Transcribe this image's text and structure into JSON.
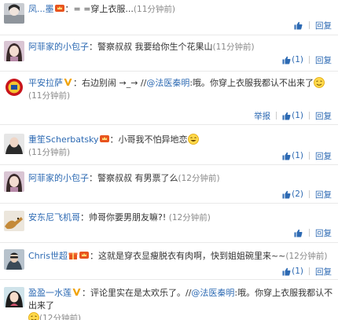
{
  "comments": [
    {
      "user": "凤...墨",
      "text": "= =穿上衣服...",
      "time": "(11分钟前)",
      "likes": "",
      "reply": "回复"
    },
    {
      "user": "阿菲家的小包子",
      "text": "警察叔叔 我要给你生个花果山",
      "time": "(11分钟前)",
      "likes": "(1)",
      "reply": "回复"
    },
    {
      "user": "平安拉萨",
      "text_before": "右边别闹 →_→ //",
      "mention": "@法医秦明",
      "text_after": ":哦。你穿上衣服我都认不出来了",
      "time": "(11分钟前)",
      "report": "举报",
      "likes": "(1)",
      "reply": "回复"
    },
    {
      "user": "重笙Scherbatsky",
      "text": "小哥我不怕异地恋",
      "time": "(11分钟前)",
      "likes": "(1)",
      "reply": "回复"
    },
    {
      "user": "阿菲家的小包子",
      "text": "警察叔叔 有男票了么",
      "time": "(12分钟前)",
      "likes": "(2)",
      "reply": "回复"
    },
    {
      "user": "安东尼飞机哥",
      "text": "帅哥你要男朋友嘛?!",
      "time": "(12分钟前)",
      "likes": "",
      "reply": "回复"
    },
    {
      "user": "Chris世超",
      "text": "这就是穿衣显瘦脱衣有肉啊，快到姐姐碗里来~~",
      "time": "(12分钟前)",
      "likes": "(1)",
      "reply": "回复"
    },
    {
      "user": "盈盈一水莲",
      "text_before": "评论里实在是太欢乐了。//",
      "mention": "@法医秦明",
      "text_after": ":哦。你穿上衣服我都认不出来了",
      "time": "(12分钟前)",
      "reply": "回复"
    }
  ],
  "icons": {
    "verified": "verified-v-icon",
    "member": "member-crown-icon",
    "thumb": "thumb-up-icon",
    "emoticon": "emoticon-icon"
  },
  "colors": {
    "link": "#2d6ab3",
    "text": "#333333",
    "time": "#8a8a8a",
    "verified": "#f0a30a",
    "member": "#e8541e"
  }
}
